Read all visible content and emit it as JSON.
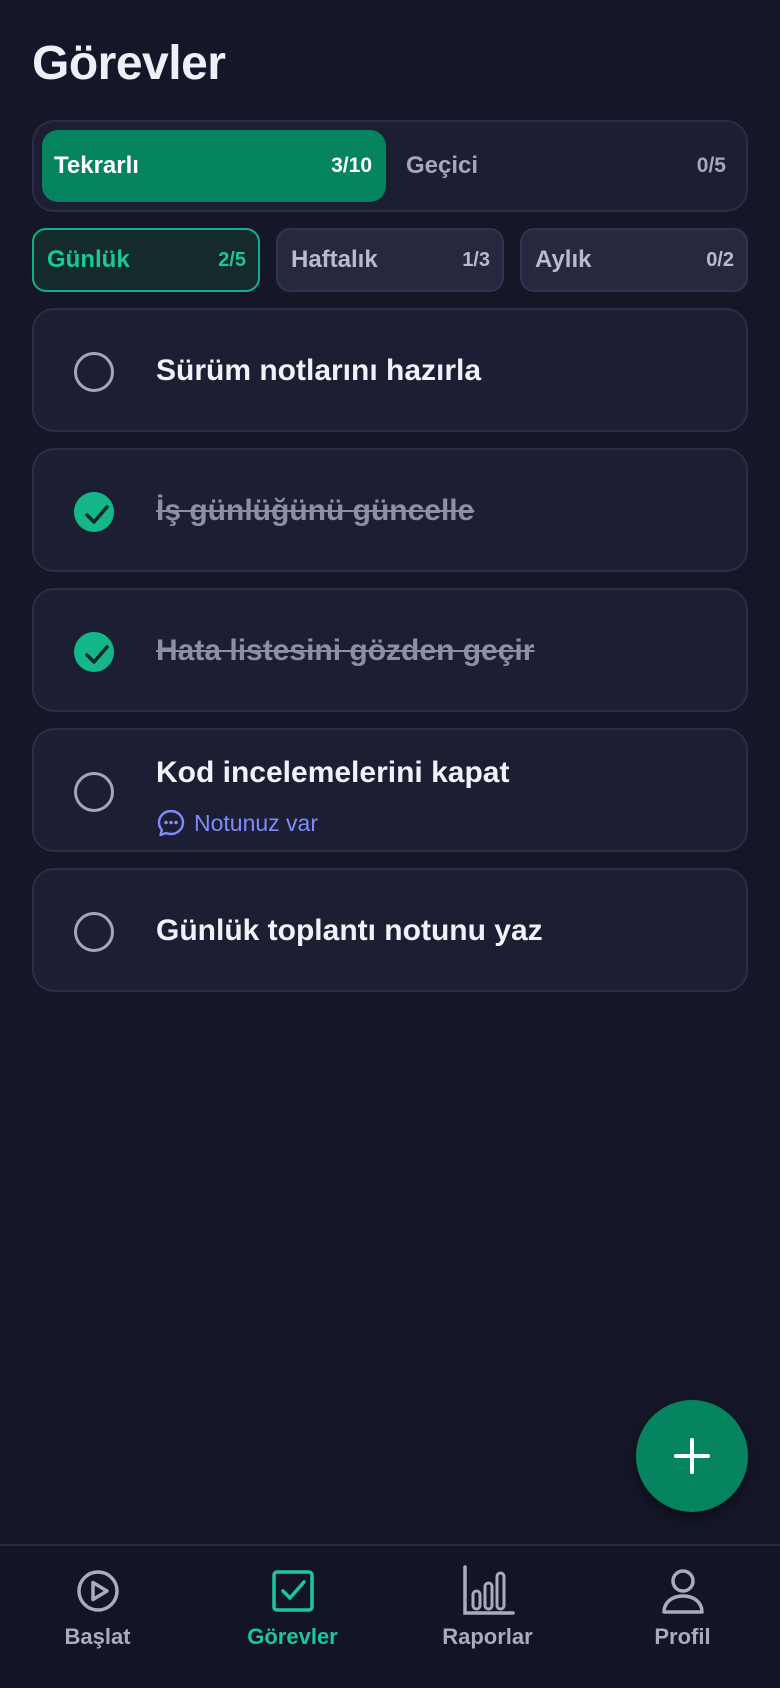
{
  "page": {
    "title": "Görevler"
  },
  "segment": {
    "items": [
      {
        "label": "Tekrarlı",
        "count": "3/10",
        "active": true
      },
      {
        "label": "Geçici",
        "count": "0/5",
        "active": false
      }
    ]
  },
  "subtabs": [
    {
      "label": "Günlük",
      "count": "2/5",
      "active": true
    },
    {
      "label": "Haftalık",
      "count": "1/3",
      "active": false
    },
    {
      "label": "Aylık",
      "count": "0/2",
      "active": false
    }
  ],
  "tasks": [
    {
      "title": "Sürüm notlarını hazırla",
      "done": false
    },
    {
      "title": "İş günlüğünü güncelle",
      "done": true
    },
    {
      "title": "Hata listesini gözden geçir",
      "done": true
    },
    {
      "title": "Kod incelemelerini kapat",
      "done": false,
      "note": "Notunuz var"
    },
    {
      "title": "Günlük toplantı notunu yaz",
      "done": false
    }
  ],
  "fab": {
    "icon": "plus-icon"
  },
  "nav": {
    "items": [
      {
        "label": "Başlat",
        "icon": "play-circle-icon",
        "active": false
      },
      {
        "label": "Görevler",
        "icon": "checkbox-icon",
        "active": true
      },
      {
        "label": "Raporlar",
        "icon": "bar-chart-icon",
        "active": false
      },
      {
        "label": "Profil",
        "icon": "user-icon",
        "active": false
      }
    ]
  },
  "colors": {
    "background": "#151729",
    "accent": "#06845f",
    "accent_bright": "#1cc79a",
    "note": "#7d8cf9"
  }
}
